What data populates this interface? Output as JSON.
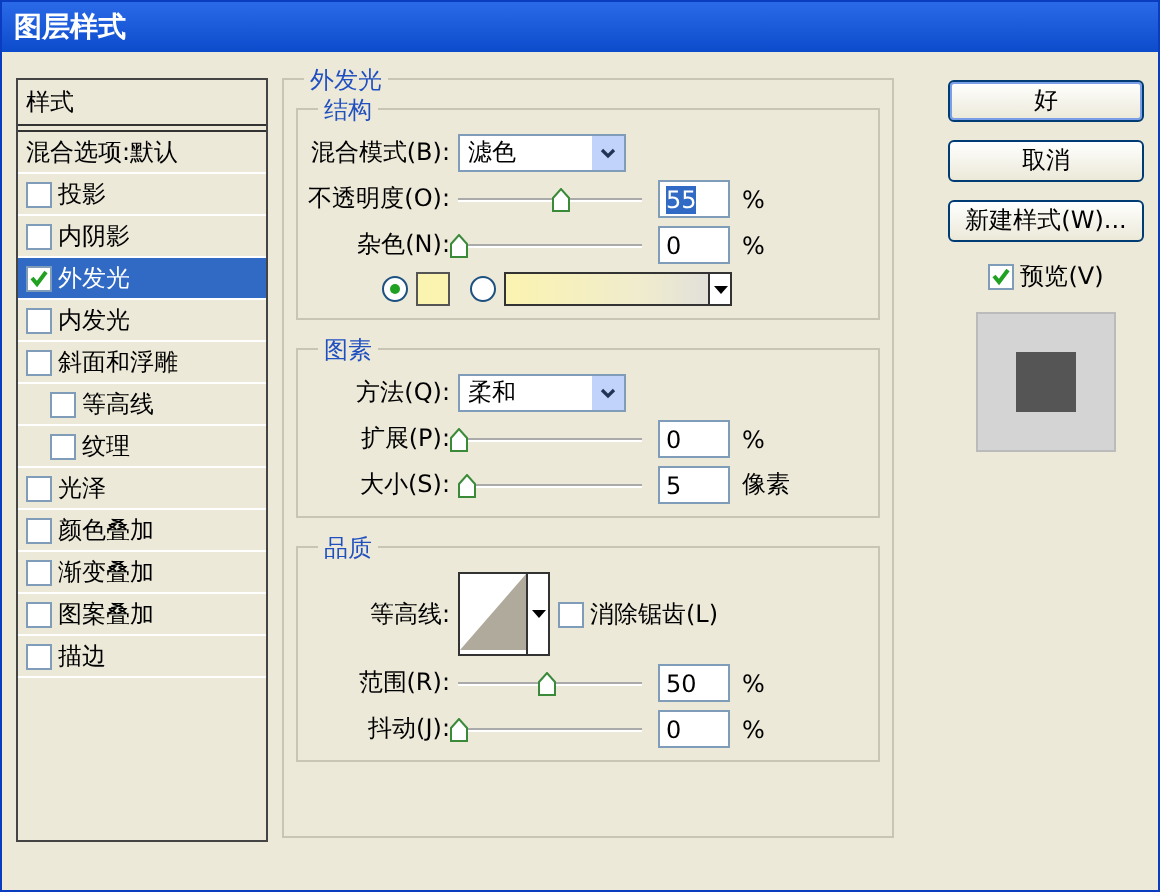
{
  "window": {
    "title": "图层样式"
  },
  "sidebar": {
    "header": "样式",
    "items": [
      {
        "kind": "plain",
        "label": "混合选项:默认",
        "selected": false
      },
      {
        "kind": "check",
        "label": "投影",
        "checked": false,
        "selected": false
      },
      {
        "kind": "check",
        "label": "内阴影",
        "checked": false,
        "selected": false
      },
      {
        "kind": "check",
        "label": "外发光",
        "checked": true,
        "selected": true
      },
      {
        "kind": "check",
        "label": "内发光",
        "checked": false,
        "selected": false
      },
      {
        "kind": "check",
        "label": "斜面和浮雕",
        "checked": false,
        "selected": false,
        "children": [
          {
            "kind": "check",
            "label": "等高线",
            "checked": false,
            "selected": false
          },
          {
            "kind": "check",
            "label": "纹理",
            "checked": false,
            "selected": false
          }
        ]
      },
      {
        "kind": "check",
        "label": "光泽",
        "checked": false,
        "selected": false
      },
      {
        "kind": "check",
        "label": "颜色叠加",
        "checked": false,
        "selected": false
      },
      {
        "kind": "check",
        "label": "渐变叠加",
        "checked": false,
        "selected": false
      },
      {
        "kind": "check",
        "label": "图案叠加",
        "checked": false,
        "selected": false
      },
      {
        "kind": "check",
        "label": "描边",
        "checked": false,
        "selected": false
      }
    ]
  },
  "panel": {
    "title": "外发光",
    "sections": [
      {
        "title": "结构",
        "rows": [
          {
            "kind": "select",
            "label": "混合模式(B):",
            "value": "滤色"
          },
          {
            "kind": "slider",
            "label": "不透明度(O):",
            "level": 0.55,
            "value": "55",
            "value_selected": true,
            "unit": "%"
          },
          {
            "kind": "slider",
            "label": "杂色(N):",
            "level": 0,
            "value": "0",
            "value_selected": false,
            "unit": "%"
          },
          {
            "kind": "fill",
            "options": [
              {
                "kind": "color",
                "selected": true,
                "color": "#fbf3b0"
              },
              {
                "kind": "gradient",
                "selected": false,
                "color": "#fbf3b0"
              }
            ]
          }
        ]
      },
      {
        "title": "图素",
        "rows": [
          {
            "kind": "select",
            "label": "方法(Q):",
            "value": "柔和"
          },
          {
            "kind": "slider",
            "label": "扩展(P):",
            "level": 0,
            "value": "0",
            "value_selected": false,
            "unit": "%"
          },
          {
            "kind": "slider",
            "label": "大小(S):",
            "level": 0.04,
            "value": "5",
            "value_selected": false,
            "unit": "像素"
          }
        ]
      },
      {
        "title": "品质",
        "rows": [
          {
            "kind": "contour",
            "label": "等高线:",
            "option": {
              "label": "消除锯齿(L)",
              "checked": false
            }
          },
          {
            "kind": "slider",
            "label": "范围(R):",
            "level": 0.48,
            "value": "50",
            "value_selected": false,
            "unit": "%"
          },
          {
            "kind": "slider",
            "label": "抖动(J):",
            "level": 0,
            "value": "0",
            "value_selected": false,
            "unit": "%"
          }
        ]
      }
    ]
  },
  "buttons": [
    {
      "label": "好",
      "default": true
    },
    {
      "label": "取消",
      "default": false
    },
    {
      "label": "新建样式(W)...",
      "default": false
    }
  ],
  "preview": {
    "label": "预览(V)",
    "checked": true
  }
}
